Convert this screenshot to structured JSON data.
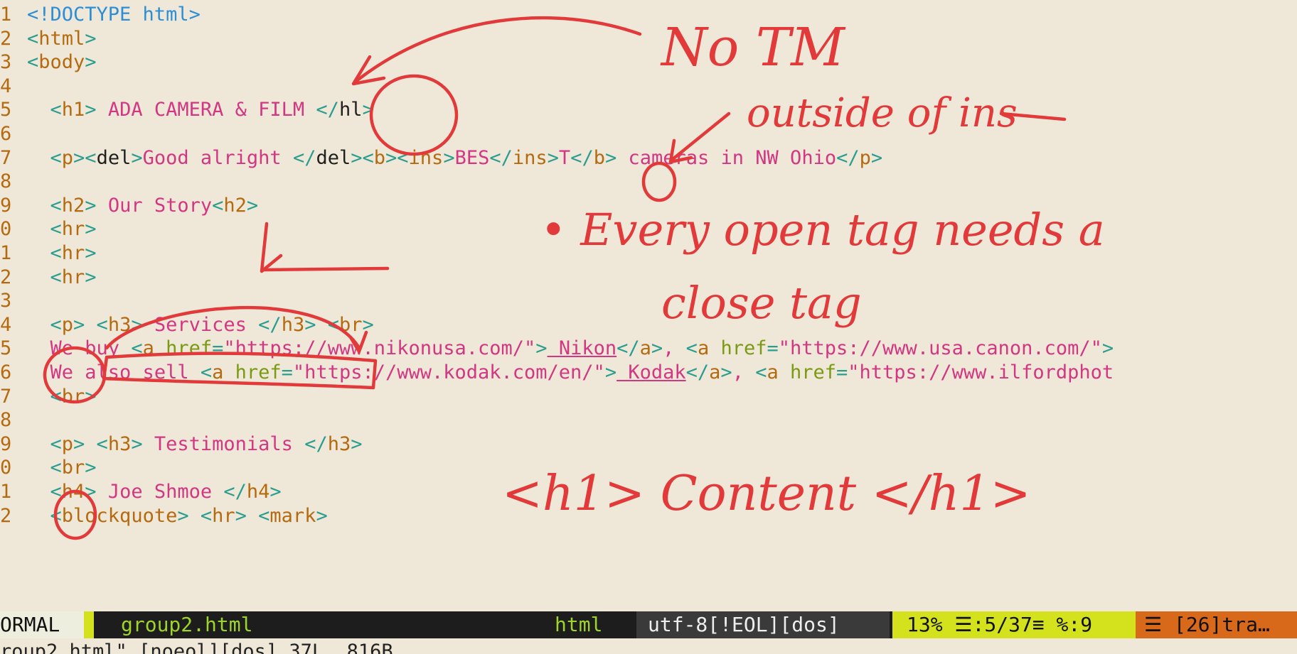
{
  "editor": {
    "lines": [
      {
        "n": "1",
        "tokens": [
          [
            "doctype",
            "<!DOCTYPE html>"
          ]
        ]
      },
      {
        "n": "2",
        "tokens": [
          [
            "tag",
            "<"
          ],
          [
            "tagname",
            "html"
          ],
          [
            "tag",
            ">"
          ]
        ]
      },
      {
        "n": "3",
        "tokens": [
          [
            "tag",
            "<"
          ],
          [
            "tagname",
            "body"
          ],
          [
            "tag",
            ">"
          ]
        ]
      },
      {
        "n": "4",
        "tokens": []
      },
      {
        "n": "5",
        "tokens": [
          [
            "dark",
            "  "
          ],
          [
            "tag",
            "<"
          ],
          [
            "tagname",
            "h1"
          ],
          [
            "tag",
            "> "
          ],
          [
            "txt",
            "ADA CAMERA & FILM "
          ],
          [
            "tag",
            "</"
          ],
          [
            "dark",
            "hl"
          ],
          [
            "tag",
            ">"
          ]
        ]
      },
      {
        "n": "6",
        "tokens": []
      },
      {
        "n": "7",
        "tokens": [
          [
            "dark",
            "  "
          ],
          [
            "tag",
            "<"
          ],
          [
            "tagname",
            "p"
          ],
          [
            "tag",
            "><"
          ],
          [
            "dark",
            "del"
          ],
          [
            "tag",
            ">"
          ],
          [
            "txt",
            "Good alright "
          ],
          [
            "tag",
            "</"
          ],
          [
            "dark",
            "del"
          ],
          [
            "tag",
            "><"
          ],
          [
            "tagname",
            "b"
          ],
          [
            "tag",
            "><"
          ],
          [
            "tagname",
            "ins"
          ],
          [
            "tag",
            ">"
          ],
          [
            "txt",
            "BES"
          ],
          [
            "tag",
            "</"
          ],
          [
            "tagname",
            "ins"
          ],
          [
            "tag",
            ">"
          ],
          [
            "txt",
            "T"
          ],
          [
            "tag",
            "</"
          ],
          [
            "tagname",
            "b"
          ],
          [
            "tag",
            "> "
          ],
          [
            "txt",
            "cameras in NW Ohio"
          ],
          [
            "tag",
            "</"
          ],
          [
            "tagname",
            "p"
          ],
          [
            "tag",
            ">"
          ]
        ]
      },
      {
        "n": "8",
        "tokens": []
      },
      {
        "n": "9",
        "tokens": [
          [
            "dark",
            "  "
          ],
          [
            "tag",
            "<"
          ],
          [
            "tagname",
            "h2"
          ],
          [
            "tag",
            "> "
          ],
          [
            "txt",
            "Our Story"
          ],
          [
            "tag",
            "<"
          ],
          [
            "tagname",
            "h2"
          ],
          [
            "tag",
            ">"
          ]
        ]
      },
      {
        "n": "0",
        "tokens": [
          [
            "dark",
            "  "
          ],
          [
            "tag",
            "<"
          ],
          [
            "tagname",
            "hr"
          ],
          [
            "tag",
            ">"
          ]
        ]
      },
      {
        "n": "1",
        "tokens": [
          [
            "dark",
            "  "
          ],
          [
            "tag",
            "<"
          ],
          [
            "tagname",
            "hr"
          ],
          [
            "tag",
            ">"
          ]
        ]
      },
      {
        "n": "2",
        "tokens": [
          [
            "dark",
            "  "
          ],
          [
            "tag",
            "<"
          ],
          [
            "tagname",
            "hr"
          ],
          [
            "tag",
            ">"
          ]
        ]
      },
      {
        "n": "3",
        "tokens": []
      },
      {
        "n": "4",
        "tokens": [
          [
            "dark",
            "  "
          ],
          [
            "tag",
            "<"
          ],
          [
            "tagname",
            "p"
          ],
          [
            "tag",
            "> <"
          ],
          [
            "tagname",
            "h3"
          ],
          [
            "tag",
            "> "
          ],
          [
            "txt",
            "Services "
          ],
          [
            "tag",
            "</"
          ],
          [
            "tagname",
            "h3"
          ],
          [
            "tag",
            "> <"
          ],
          [
            "tagname",
            "br"
          ],
          [
            "tag",
            ">"
          ]
        ]
      },
      {
        "n": "5",
        "tokens": [
          [
            "dark",
            "  "
          ],
          [
            "txt",
            "We buy "
          ],
          [
            "tag",
            "<"
          ],
          [
            "tagname",
            "a "
          ],
          [
            "attr",
            "href"
          ],
          [
            "tag",
            "="
          ],
          [
            "str",
            "\"https://www.nikonusa.com/\""
          ],
          [
            "tag",
            ">"
          ],
          [
            "strul",
            " Nikon"
          ],
          [
            "tag",
            "</"
          ],
          [
            "tagname",
            "a"
          ],
          [
            "tag",
            ">"
          ],
          [
            "txt",
            ", "
          ],
          [
            "tag",
            "<"
          ],
          [
            "tagname",
            "a "
          ],
          [
            "attr",
            "href"
          ],
          [
            "tag",
            "="
          ],
          [
            "str",
            "\"https://www.usa.canon.com/\""
          ],
          [
            "tag",
            ">"
          ]
        ]
      },
      {
        "n": "6",
        "tokens": [
          [
            "dark",
            "  "
          ],
          [
            "txt",
            "We also sell "
          ],
          [
            "tag",
            "<"
          ],
          [
            "tagname",
            "a "
          ],
          [
            "attr",
            "href"
          ],
          [
            "tag",
            "="
          ],
          [
            "str",
            "\"https://www.kodak.com/en/\""
          ],
          [
            "tag",
            ">"
          ],
          [
            "strul",
            " Kodak"
          ],
          [
            "tag",
            "</"
          ],
          [
            "tagname",
            "a"
          ],
          [
            "tag",
            ">"
          ],
          [
            "txt",
            ", "
          ],
          [
            "tag",
            "<"
          ],
          [
            "tagname",
            "a "
          ],
          [
            "attr",
            "href"
          ],
          [
            "tag",
            "="
          ],
          [
            "str",
            "\"https://www.ilfordphot"
          ]
        ]
      },
      {
        "n": "7",
        "tokens": [
          [
            "dark",
            "  "
          ],
          [
            "tag",
            "<"
          ],
          [
            "tagname",
            "br"
          ],
          [
            "tag",
            ">"
          ]
        ]
      },
      {
        "n": "8",
        "tokens": []
      },
      {
        "n": "9",
        "tokens": [
          [
            "dark",
            "  "
          ],
          [
            "tag",
            "<"
          ],
          [
            "tagname",
            "p"
          ],
          [
            "tag",
            "> <"
          ],
          [
            "tagname",
            "h3"
          ],
          [
            "tag",
            "> "
          ],
          [
            "txt",
            "Testimonials "
          ],
          [
            "tag",
            "</"
          ],
          [
            "tagname",
            "h3"
          ],
          [
            "tag",
            ">"
          ]
        ]
      },
      {
        "n": "0",
        "tokens": [
          [
            "dark",
            "  "
          ],
          [
            "tag",
            "<"
          ],
          [
            "tagname",
            "br"
          ],
          [
            "tag",
            ">"
          ]
        ]
      },
      {
        "n": "1",
        "tokens": [
          [
            "dark",
            "  "
          ],
          [
            "tag",
            "<"
          ],
          [
            "tagname",
            "h4"
          ],
          [
            "tag",
            "> "
          ],
          [
            "txt",
            "Joe Shmoe "
          ],
          [
            "tag",
            "</"
          ],
          [
            "tagname",
            "h4"
          ],
          [
            "tag",
            ">"
          ]
        ]
      },
      {
        "n": "2",
        "tokens": [
          [
            "dark",
            "  "
          ],
          [
            "tag",
            "<"
          ],
          [
            "tagname",
            "blockquote"
          ],
          [
            "tag",
            "> <"
          ],
          [
            "tagname",
            "hr"
          ],
          [
            "tag",
            "> <"
          ],
          [
            "tagname",
            "mark"
          ],
          [
            "tag",
            ">"
          ]
        ]
      }
    ]
  },
  "statusbar": {
    "mode": "ORMAL",
    "filename": "group2.html",
    "filetype": "html",
    "encoding": "utf-8[!EOL][dos]",
    "position": "13% ☰:5/37≡ %:9",
    "warning": "☰ [26]tra…"
  },
  "cmdline": "roup2.html\" [noeol][dos] 37L, 816B",
  "annotations": {
    "no_tm": "No TM",
    "outside_ins": "outside of ins",
    "rule_line1": "• Every open tag needs a",
    "rule_line2": "close tag",
    "example": "<h1> Content </h1>"
  },
  "colors": {
    "background": "#efe8d8",
    "annotation_ink": "#e23a3a",
    "statusbar_bg": "#1d1d1d",
    "mode_bg": "#eeeede",
    "position_bg": "#d4e21e",
    "warning_bg": "#d9691a"
  }
}
